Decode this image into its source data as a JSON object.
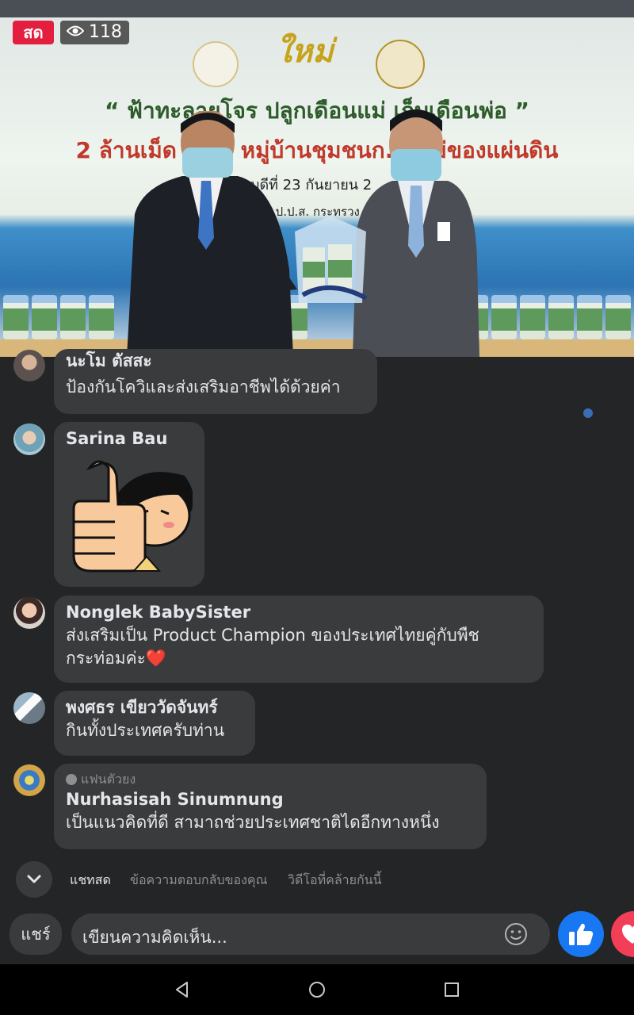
{
  "video": {
    "live_label": "สด",
    "viewer_count": "118",
    "banner_line1": "“ ฟ้าทะลายโจร ปลูกเดือนแม่ เก็บเดือนพ่อ ”",
    "banner_line2": "2 ล้านเม็ด 2 ... หมู่บ้านชุมชนก... แม่ของแผ่นดิน",
    "banner_line3": "วันพฤหัสบดีที่ 23 กันยายน 2",
    "banner_line4": "สำนักงาน ป.ป.ส. กระทรวง"
  },
  "comments": [
    {
      "name": "นะโม ตัสสะ",
      "text": "ป้องกันโควิและส่งเสริมอาชีพได้ด้วยค่า"
    },
    {
      "name": "Sarina Bau",
      "sticker": "thumbs-up-sticker"
    },
    {
      "name": "Nonglek BabySister",
      "text_line1": "ส่งเสริมเป็น Product Champion ของประเทศไทยคู่กับพืช",
      "text_line2": "กระท่อมค่ะ",
      "emoji": "❤️"
    },
    {
      "name": "พงศธร เขียววัดจันทร์",
      "text": "กินทั้งประเทศครับท่าน"
    },
    {
      "badge": "แฟนตัวยง",
      "name": "Nurhasisah Sinumnung",
      "text": "เป็นแนวคิดที่ดี สามาถช่วยประเทศชาติไดอีกทางหนึ่ง"
    }
  ],
  "tabs": [
    "แชทสด",
    "ข้อความตอบกลับของคุณ",
    "วิดีโอที่คล้ายกันนี้"
  ],
  "composer": {
    "share_label": "แชร์",
    "placeholder": "เขียนความคิดเห็น..."
  },
  "colors": {
    "live_red": "#e41e3f",
    "like_blue": "#1877f2",
    "love_red": "#f33e58",
    "bubble": "#3a3b3c",
    "background": "#242526"
  },
  "icons": [
    "eye-icon",
    "chevron-down-icon",
    "smiley-icon",
    "like-icon",
    "love-icon",
    "back-icon",
    "home-icon",
    "recents-icon"
  ]
}
